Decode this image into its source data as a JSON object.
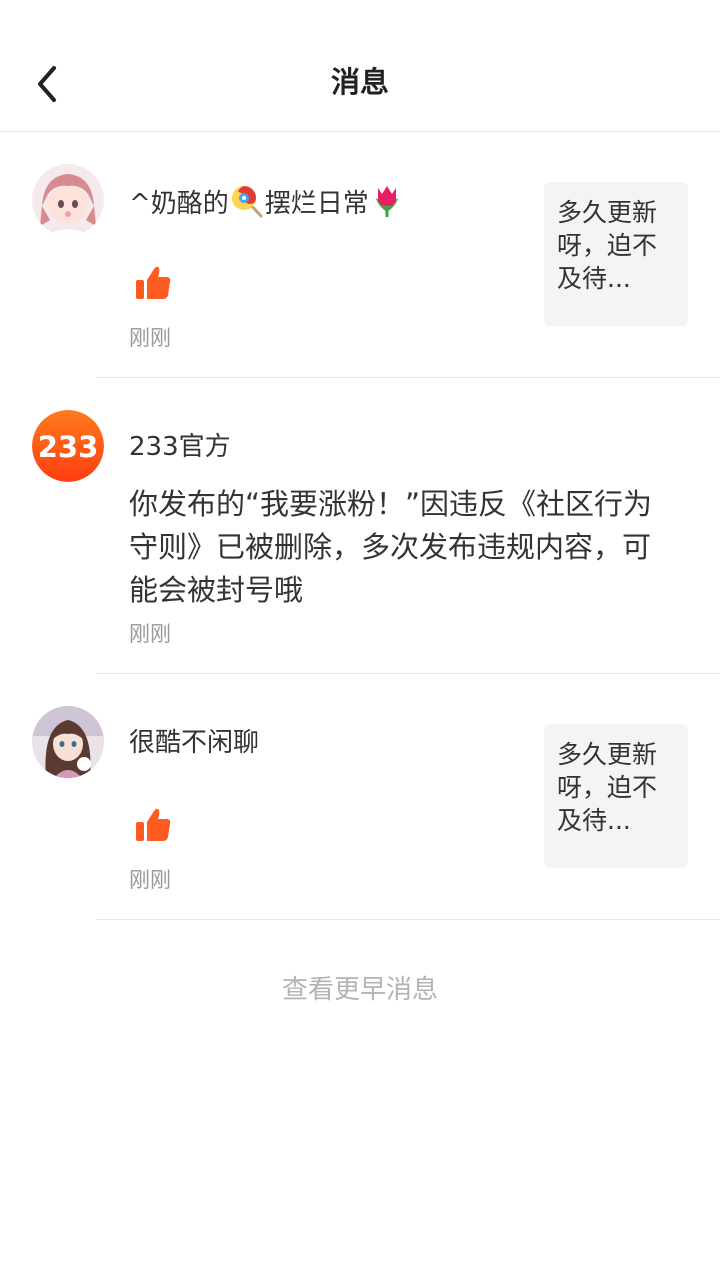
{
  "header": {
    "title": "消息",
    "back_icon": "chevron-left-icon"
  },
  "messages": [
    {
      "name_prefix": "^奶酪的",
      "name_middle": "摆烂日常",
      "emoji_1": "lollipop-icon",
      "emoji_2": "tulip-icon",
      "action_icon": "thumbs-up-icon",
      "time": "刚刚",
      "quote": "多久更新呀，迫不及待..."
    },
    {
      "name": "233官方",
      "avatar_text": "233",
      "body": "你发布的“我要涨粉！”因违反《社区行为守则》已被删除，多次发布违规内容，可能会被封号哦",
      "time": "刚刚"
    },
    {
      "name": "很酷不闲聊",
      "action_icon": "thumbs-up-icon",
      "time": "刚刚",
      "quote": "多久更新呀，迫不及待..."
    }
  ],
  "footer": {
    "more_label": "查看更早消息"
  },
  "colors": {
    "accent": "#ff5a1f",
    "text": "#333333",
    "muted": "#999999",
    "quote_bg": "#f4f4f4"
  }
}
